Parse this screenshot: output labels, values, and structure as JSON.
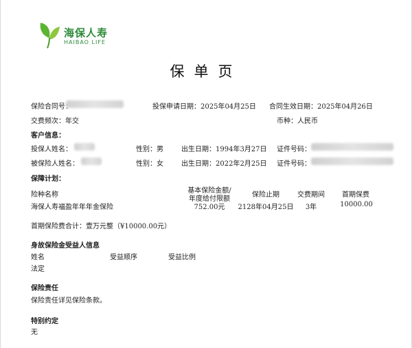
{
  "logo": {
    "cn": "海保人寿",
    "en": "HAIBAO LIFE",
    "color": "#2e8b3a",
    "icon": "leaf-logo-icon"
  },
  "title": "保单页",
  "policy_info": {
    "contract_label": "保险合同号：",
    "apply_date": "投保申请日期：2025年04月25日",
    "effective_date": "合同生效日期：2025年04月26日",
    "payment_freq": "交费频次：年交",
    "currency": "币种：人民币"
  },
  "customer": {
    "heading": "客户信息：",
    "policyholder": {
      "name_label": "投保人姓名：",
      "gender": "性别：男",
      "birth": "出生日期：1994年3月27日",
      "id_label": "证件号码："
    },
    "insured": {
      "name_label": "被保险人姓名：",
      "gender": "性别：女",
      "birth": "出生日期：2022年2月25日",
      "id_label": "证件号码："
    }
  },
  "coverage": {
    "heading": "保障计划：",
    "headers": {
      "name": "险种名称",
      "amount_line1": "基本保险金额/",
      "amount_line2": "年度给付限额",
      "end": "保险止期",
      "term": "交费期间",
      "premium": "首期保费"
    },
    "row": {
      "name": "海保人寿福盈年年年金保险",
      "amount": "752.00元",
      "end": "2128年04月25日",
      "term": "3年",
      "premium": "10000.00"
    },
    "total": "首期保险费合计：壹万元整（¥10000.00元）"
  },
  "beneficiary": {
    "heading": "身故保险金受益人信息",
    "col_name": "姓名",
    "col_order": "受益顺序",
    "col_ratio": "受益比例",
    "value": "法定"
  },
  "liability": {
    "heading": "保险责任",
    "text": "保险责任详见保险条款。"
  },
  "special": {
    "heading": "特别约定",
    "text": "无"
  }
}
